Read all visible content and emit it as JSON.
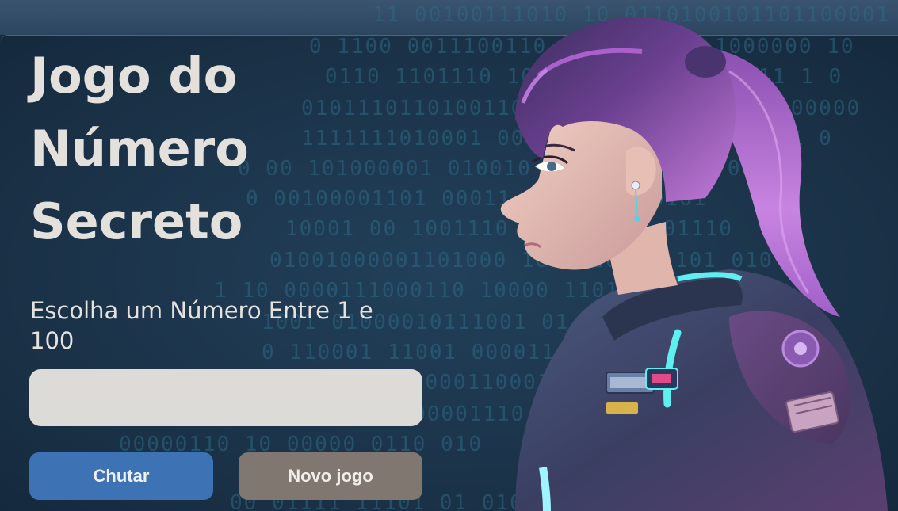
{
  "colors": {
    "background": "#1b3349",
    "title": "#e4e1dc",
    "primary_button": "#3d72b4",
    "secondary_button": "#807870",
    "input_background": "#dddbd8"
  },
  "header": {
    "title": "Jogo do Número Secreto"
  },
  "form": {
    "prompt": "Escolha um Número Entre 1 e 100",
    "input_value": ""
  },
  "buttons": {
    "guess_label": "Chutar",
    "new_game_label": "Novo jogo"
  },
  "illustration": {
    "icon": "astronaut-girl-illustration"
  }
}
